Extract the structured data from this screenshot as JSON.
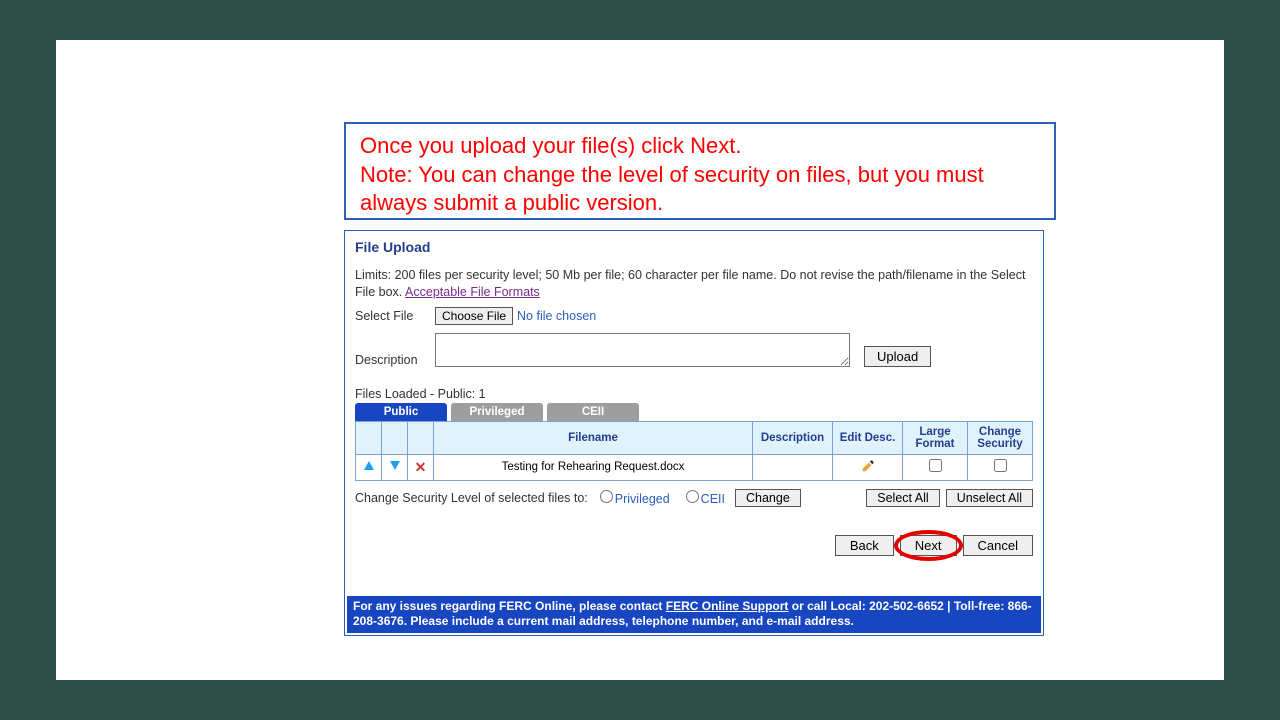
{
  "callout": {
    "line1": "Once you upload your file(s) click Next.",
    "line2": "Note: You can change the level of security on files, but you must always submit a public version."
  },
  "section_title": "File Upload",
  "limits": {
    "text": "Limits: 200 files per security level; 50 Mb per file; 60 character per file name. Do not revise the path/filename in the Select File box. ",
    "link": "Acceptable File Formats"
  },
  "form": {
    "select_file_label": "Select File",
    "choose_file_btn": "Choose File",
    "no_file": "No file chosen",
    "description_label": "Description",
    "description_value": "",
    "upload_btn": "Upload"
  },
  "files_loaded_label": "Files Loaded - Public: 1",
  "tabs": [
    {
      "label": "Public",
      "active": true
    },
    {
      "label": "Privileged",
      "active": false
    },
    {
      "label": "CEII",
      "active": false
    }
  ],
  "grid": {
    "headers": {
      "filename": "Filename",
      "description": "Description",
      "edit_desc": "Edit Desc.",
      "large_format": "Large Format",
      "change_security": "Change Security"
    },
    "rows": [
      {
        "filename": "Testing for Rehearing Request.docx",
        "description": "",
        "large_format_checked": false,
        "change_security_checked": false
      }
    ]
  },
  "change_security": {
    "label": "Change Security Level of selected files to:",
    "options": [
      "Privileged",
      "CEII"
    ],
    "change_btn": "Change",
    "select_all_btn": "Select All",
    "unselect_all_btn": "Unselect All"
  },
  "nav": {
    "back": "Back",
    "next": "Next",
    "cancel": "Cancel"
  },
  "footer": {
    "part1": "For any issues regarding FERC Online, please contact ",
    "link": "FERC Online Support",
    "part2": " or call Local: 202-502-6652 | Toll-free: 866-208-3676. Please include a current mail address, telephone number, and e-mail address."
  }
}
